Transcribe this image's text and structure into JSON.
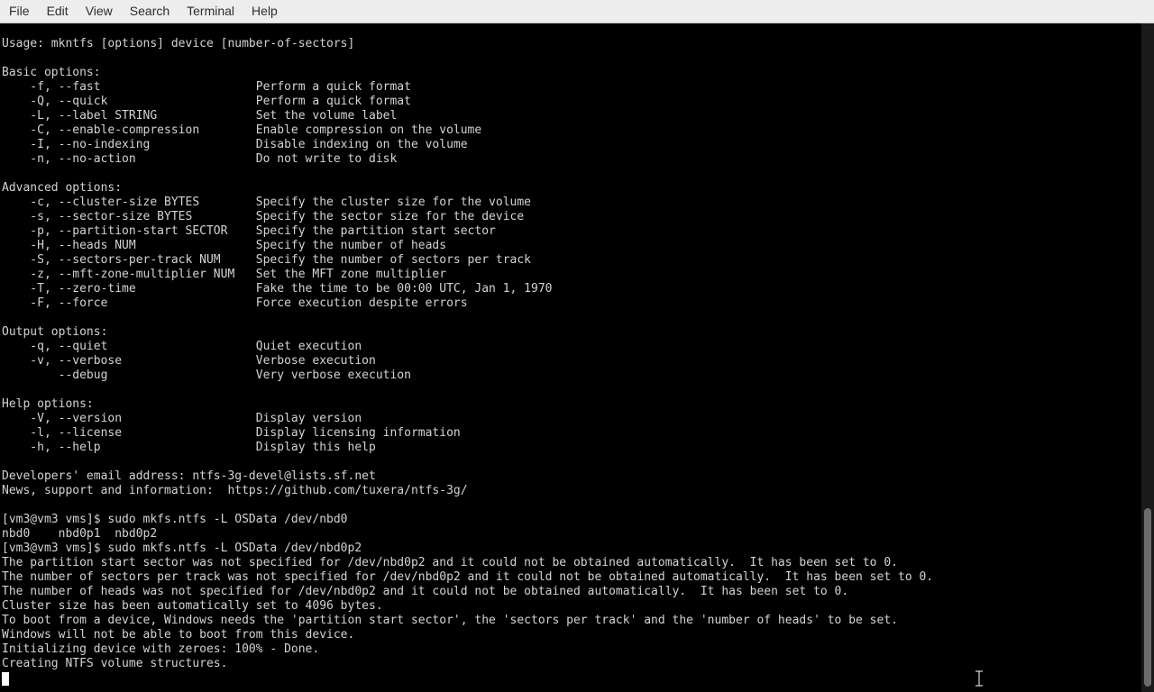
{
  "menubar": {
    "items": [
      "File",
      "Edit",
      "View",
      "Search",
      "Terminal",
      "Help"
    ]
  },
  "terminal": {
    "lines": [
      "Usage: mkntfs [options] device [number-of-sectors]",
      "",
      "Basic options:",
      "    -f, --fast                      Perform a quick format",
      "    -Q, --quick                     Perform a quick format",
      "    -L, --label STRING              Set the volume label",
      "    -C, --enable-compression        Enable compression on the volume",
      "    -I, --no-indexing               Disable indexing on the volume",
      "    -n, --no-action                 Do not write to disk",
      "",
      "Advanced options:",
      "    -c, --cluster-size BYTES        Specify the cluster size for the volume",
      "    -s, --sector-size BYTES         Specify the sector size for the device",
      "    -p, --partition-start SECTOR    Specify the partition start sector",
      "    -H, --heads NUM                 Specify the number of heads",
      "    -S, --sectors-per-track NUM     Specify the number of sectors per track",
      "    -z, --mft-zone-multiplier NUM   Set the MFT zone multiplier",
      "    -T, --zero-time                 Fake the time to be 00:00 UTC, Jan 1, 1970",
      "    -F, --force                     Force execution despite errors",
      "",
      "Output options:",
      "    -q, --quiet                     Quiet execution",
      "    -v, --verbose                   Verbose execution",
      "        --debug                     Very verbose execution",
      "",
      "Help options:",
      "    -V, --version                   Display version",
      "    -l, --license                   Display licensing information",
      "    -h, --help                      Display this help",
      "",
      "Developers' email address: ntfs-3g-devel@lists.sf.net",
      "News, support and information:  https://github.com/tuxera/ntfs-3g/",
      "",
      "[vm3@vm3 vms]$ sudo mkfs.ntfs -L OSData /dev/nbd0",
      "nbd0    nbd0p1  nbd0p2",
      "[vm3@vm3 vms]$ sudo mkfs.ntfs -L OSData /dev/nbd0p2",
      "The partition start sector was not specified for /dev/nbd0p2 and it could not be obtained automatically.  It has been set to 0.",
      "The number of sectors per track was not specified for /dev/nbd0p2 and it could not be obtained automatically.  It has been set to 0.",
      "The number of heads was not specified for /dev/nbd0p2 and it could not be obtained automatically.  It has been set to 0.",
      "Cluster size has been automatically set to 4096 bytes.",
      "To boot from a device, Windows needs the 'partition start sector', the 'sectors per track' and the 'number of heads' to be set.",
      "Windows will not be able to boot from this device.",
      "Initializing device with zeroes: 100% - Done.",
      "Creating NTFS volume structures."
    ]
  },
  "colors": {
    "background": "#000000",
    "foreground": "#d3d3d3",
    "menubar_bg": "#ededed"
  }
}
